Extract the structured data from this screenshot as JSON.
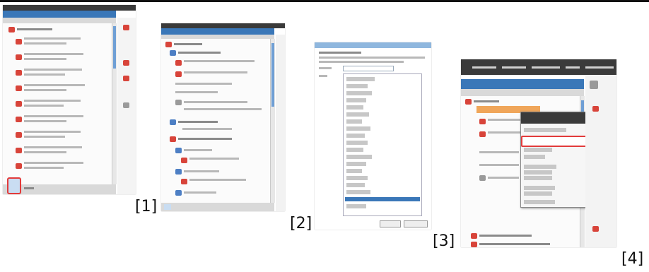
{
  "captions": [
    "[1]",
    "[2]",
    "[3]",
    "[4]"
  ],
  "colors": {
    "accent": "#3a77b8",
    "highlight": "#e23b3b",
    "toolbar": "#3a3a3a"
  },
  "icons": [
    "document-icon",
    "folder-icon",
    "globe-icon",
    "menu-icon"
  ]
}
